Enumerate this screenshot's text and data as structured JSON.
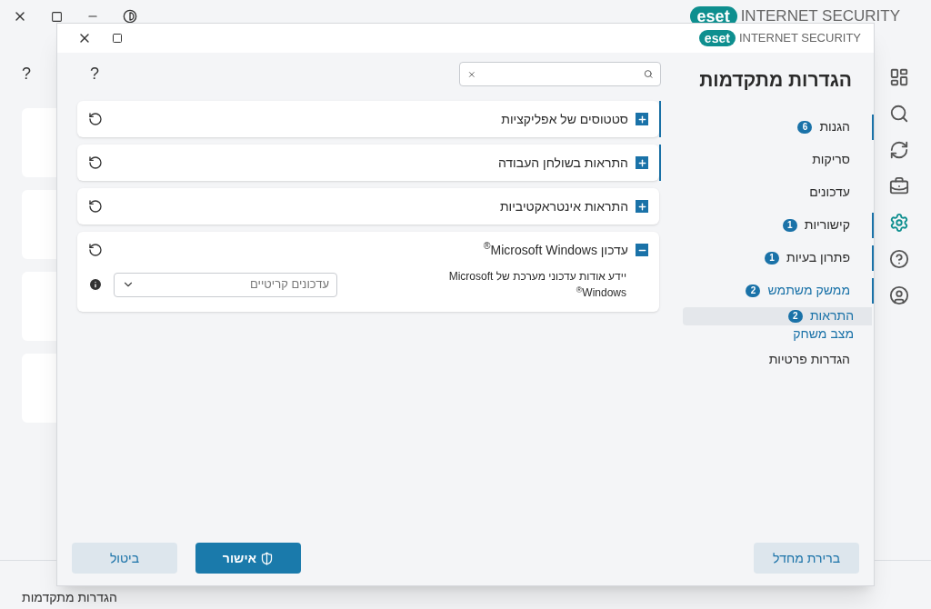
{
  "background": {
    "logo": "eset",
    "brand": "INTERNET SECURITY",
    "help": "?",
    "footer_text": "הגדרות מתקדמות"
  },
  "dialog": {
    "logo": "eset",
    "brand": "INTERNET SECURITY",
    "title": "הגדרות מתקדמות",
    "help": "?",
    "nav": [
      {
        "label": "הגנות",
        "badge": "6",
        "selected": false
      },
      {
        "label": "סריקות",
        "selected": false
      },
      {
        "label": "עדכונים",
        "selected": false
      },
      {
        "label": "קישוריות",
        "badge": "1",
        "selected": false
      },
      {
        "label": "פתרון בעיות",
        "badge": "1",
        "selected": false
      },
      {
        "label": "ממשק משתמש",
        "badge": "2",
        "selected": false,
        "expanded": true,
        "children": [
          {
            "label": "התראות",
            "badge": "2",
            "selected": true
          },
          {
            "label": "מצב משחק",
            "selected": false
          }
        ]
      },
      {
        "label": "הגדרות פרטיות",
        "selected": false
      }
    ],
    "sections": [
      {
        "title": "סטטוסים של אפליקציות",
        "expanded": false,
        "modified": true
      },
      {
        "title": "התראות בשולחן העבודה",
        "expanded": false,
        "modified": true
      },
      {
        "title": "התראות אינטראקטיביות",
        "expanded": false,
        "modified": false
      },
      {
        "title": "עדכון Microsoft Windows$^{®}$",
        "expanded": true,
        "modified": false,
        "rows": [
          {
            "label": "יידע אודות עדכוני מערכת של Microsoft Windows$^{®}$",
            "value": "עדכונים קריטיים"
          }
        ]
      }
    ],
    "buttons": {
      "default": "ברירת מחדל",
      "ok": "אישור",
      "cancel": "ביטול"
    }
  }
}
